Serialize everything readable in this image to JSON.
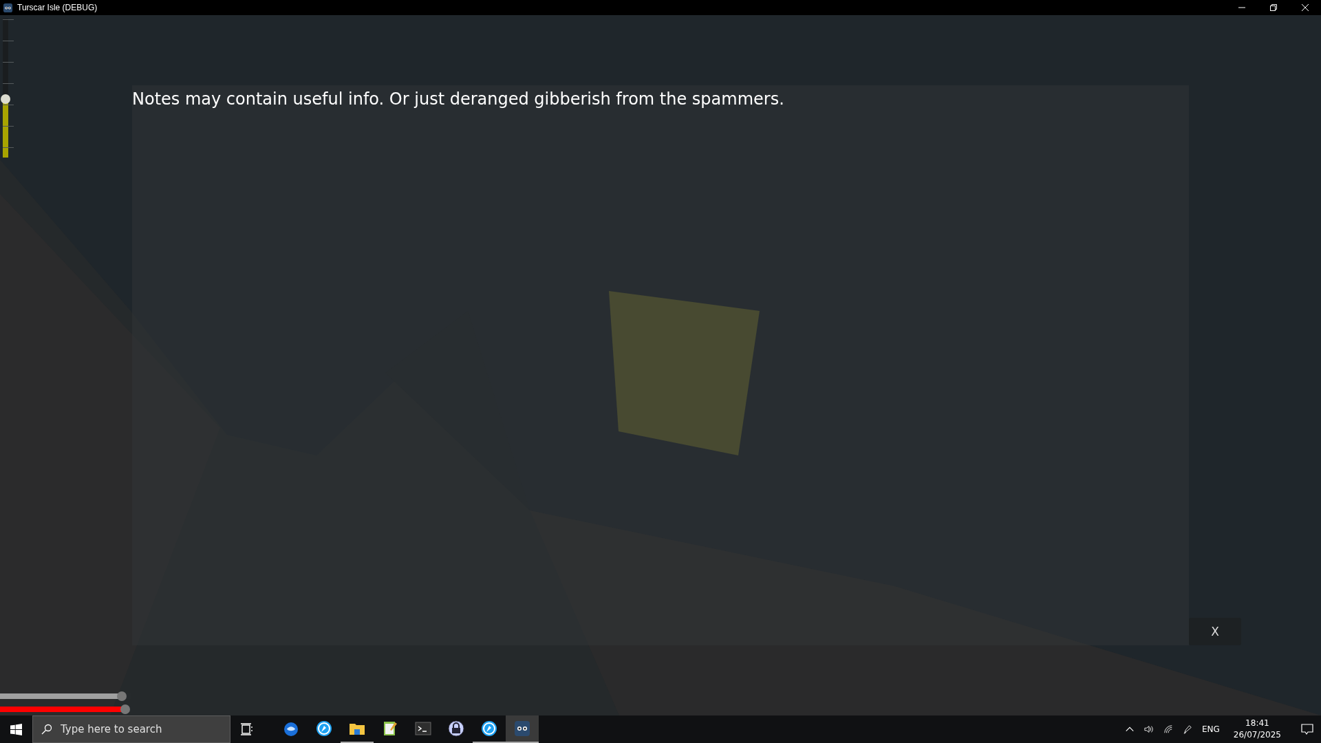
{
  "window": {
    "title": "Turscar Isle (DEBUG)"
  },
  "hud": {
    "vertical_slider": {
      "level": 0.42
    },
    "bars": [
      {
        "color": "#a0a0a0",
        "level": 0.93
      },
      {
        "color": "#ff0000",
        "level": 0.96
      }
    ]
  },
  "notes_panel": {
    "text": "Notes may contain useful info. Or just deranged gibberish from the spammers.",
    "close_button": "X"
  },
  "taskbar": {
    "search": {
      "placeholder": "Type here to search"
    },
    "apps": [
      {
        "kind": "mail",
        "running": false,
        "active": false
      },
      {
        "kind": "browser",
        "running": false,
        "active": false
      },
      {
        "kind": "folder",
        "running": true,
        "active": false
      },
      {
        "kind": "notepad",
        "running": false,
        "active": false
      },
      {
        "kind": "terminal",
        "running": false,
        "active": false
      },
      {
        "kind": "lock",
        "running": false,
        "active": false
      },
      {
        "kind": "browser",
        "running": true,
        "active": false
      },
      {
        "kind": "game",
        "running": true,
        "active": true
      }
    ],
    "tray": {
      "language": "ENG",
      "time": "18:41",
      "date": "26/07/2025"
    }
  }
}
